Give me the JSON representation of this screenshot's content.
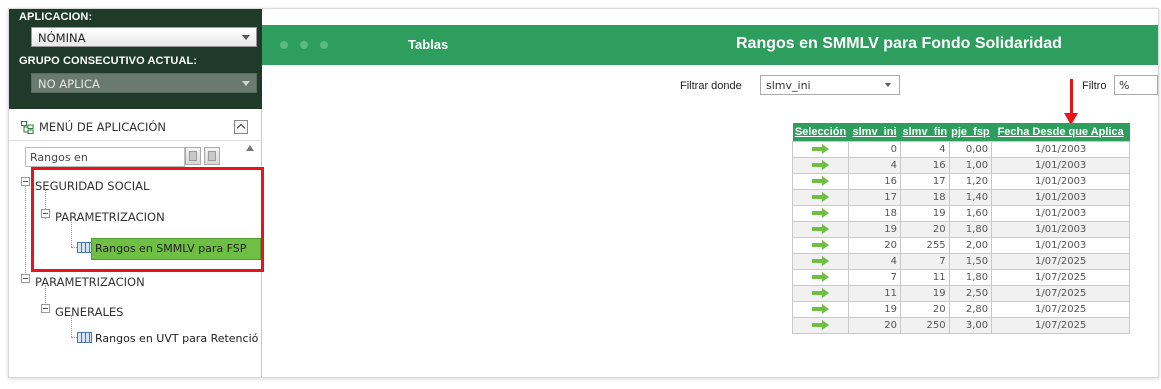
{
  "sidebar": {
    "app_label": "APLICACION:",
    "app_value": "NÓMINA",
    "group_label": "GRUPO CONSECUTIVO ACTUAL:",
    "group_value": "NO APLICA",
    "menu_title": "MENÚ DE APLICACIÓN",
    "search_value": "Rangos en",
    "tree": {
      "node1": "SEGURIDAD SOCIAL",
      "node1_child": "PARAMETRIZACION",
      "node1_leaf": "Rangos en SMMLV para FSP",
      "node2": "PARAMETRIZACION",
      "node2_child": "GENERALES",
      "node2_leaf": "Rangos en UVT para Retención"
    }
  },
  "header": {
    "tablas": "Tablas",
    "title": "Rangos en SMMLV para Fondo Solidaridad"
  },
  "filter": {
    "label": "Filtrar donde",
    "field_value": "slmv_ini",
    "filtro_label": "Filtro",
    "filtro_value": "%"
  },
  "table": {
    "columns": [
      "Selección",
      "slmv_ini",
      "slmv_fin",
      "pje_fsp",
      "Fecha Desde que Aplica"
    ],
    "rows": [
      [
        "0",
        "4",
        "0,00",
        "1/01/2003"
      ],
      [
        "4",
        "16",
        "1,00",
        "1/01/2003"
      ],
      [
        "16",
        "17",
        "1,20",
        "1/01/2003"
      ],
      [
        "17",
        "18",
        "1,40",
        "1/01/2003"
      ],
      [
        "18",
        "19",
        "1,60",
        "1/01/2003"
      ],
      [
        "19",
        "20",
        "1,80",
        "1/01/2003"
      ],
      [
        "20",
        "255",
        "2,00",
        "1/01/2003"
      ],
      [
        "4",
        "7",
        "1,50",
        "1/07/2025"
      ],
      [
        "7",
        "11",
        "1,80",
        "1/07/2025"
      ],
      [
        "11",
        "19",
        "2,50",
        "1/07/2025"
      ],
      [
        "19",
        "20",
        "2,80",
        "1/07/2025"
      ],
      [
        "20",
        "250",
        "3,00",
        "1/07/2025"
      ]
    ]
  },
  "colors": {
    "header_green": "#2e9e5e",
    "sidebar_dark": "#1f3a28",
    "selected_leaf": "#6fbf44",
    "annotation_red": "#e8141a"
  },
  "icons": {
    "select_row": "arrow-right-icon",
    "tree_table": "table-icon",
    "menu": "tree-menu-icon"
  }
}
